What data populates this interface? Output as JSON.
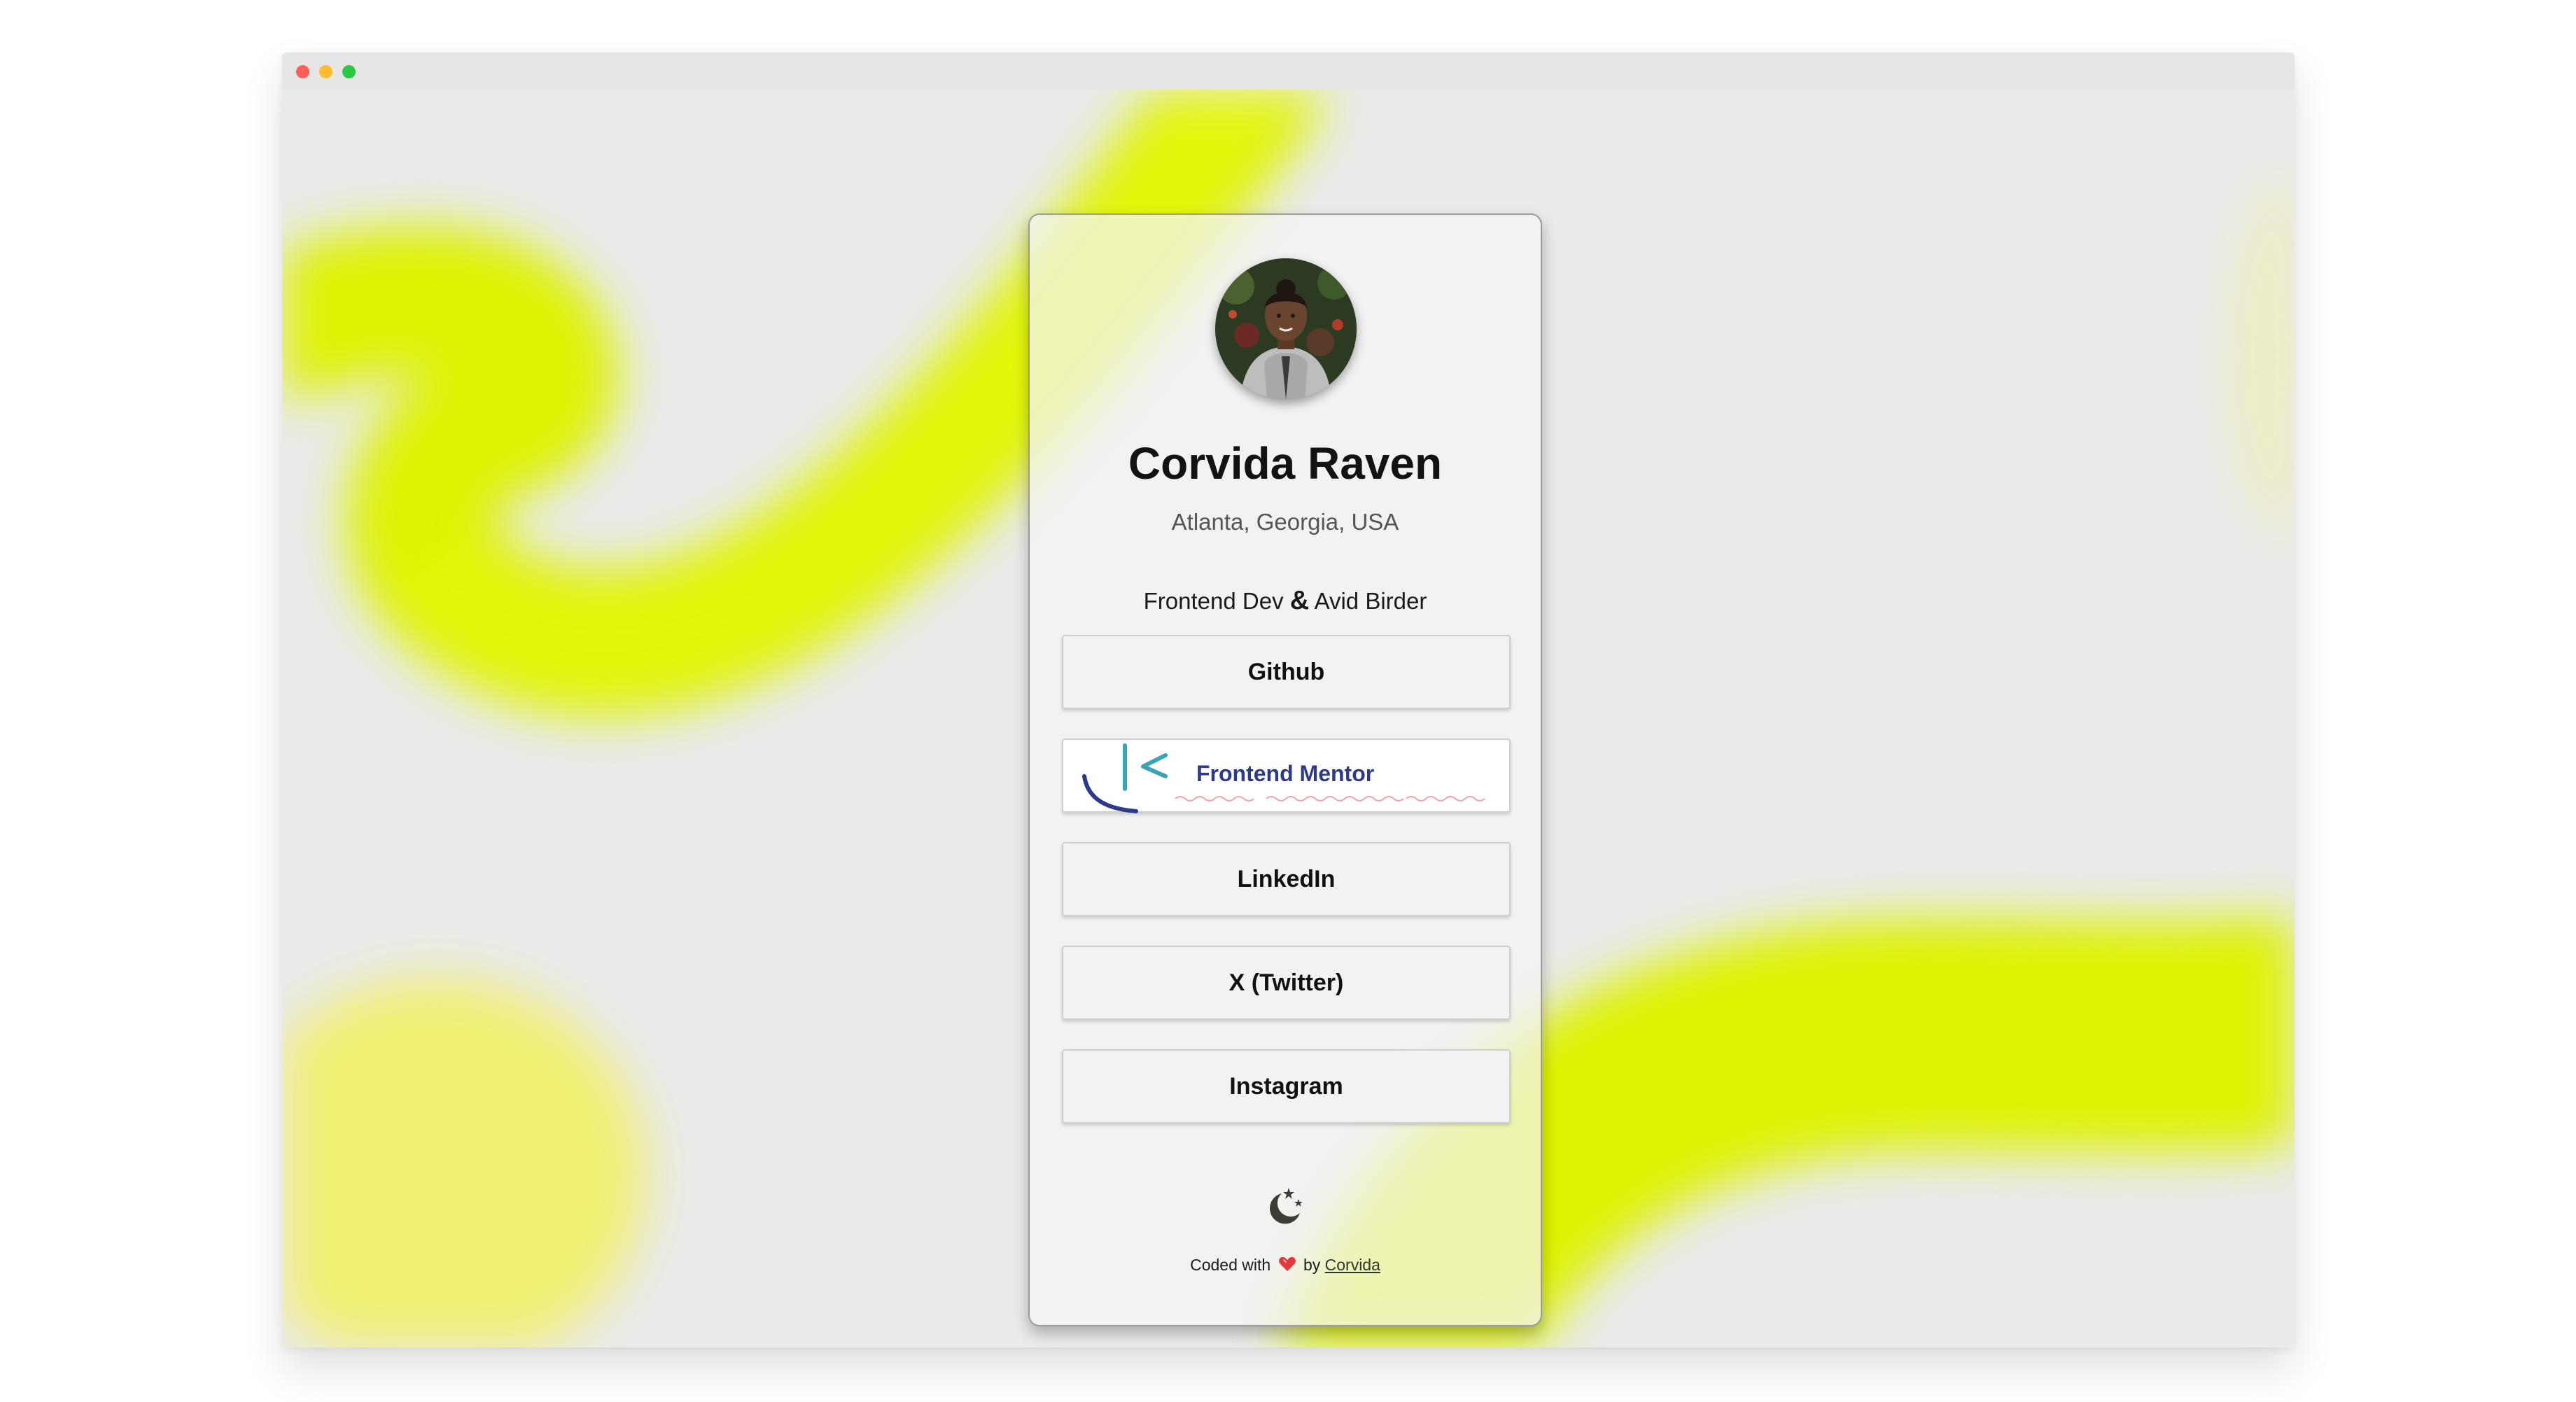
{
  "window": {
    "controls": [
      "close",
      "minimize",
      "maximize"
    ]
  },
  "profile": {
    "name": "Corvida Raven",
    "location": "Atlanta, Georgia, USA",
    "tagline_part1": "Frontend Dev",
    "tagline_amp": "&",
    "tagline_part2": "Avid Birder",
    "avatar_icon": "profile-photo"
  },
  "links": [
    {
      "label": "Github"
    },
    {
      "label": "Frontend Mentor",
      "style": "logo"
    },
    {
      "label": "LinkedIn"
    },
    {
      "label": "X (Twitter)"
    },
    {
      "label": "Instagram"
    }
  ],
  "theme_toggle": {
    "icon": "moon-stars-icon"
  },
  "footer": {
    "prefix": "Coded with",
    "heart_icon": "heart-icon",
    "middle": "by",
    "author_link": "Corvida"
  },
  "colors": {
    "accent_lime": "#dff500",
    "background": "#ebebeb",
    "card": "#f4f4f4",
    "frontend_mentor_blue": "#2d3a8c",
    "frontend_mentor_teal": "#3ba3b8"
  }
}
